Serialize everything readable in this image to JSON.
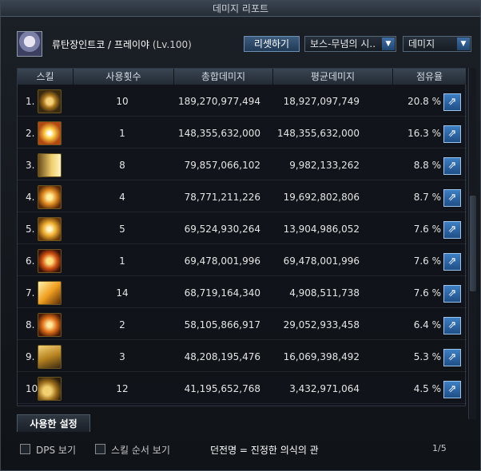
{
  "window": {
    "title": "데미지 리포트"
  },
  "header": {
    "char_name": "류탄장인트코 / 프레이야",
    "level": "(Lv.100)",
    "reset_label": "리셋하기",
    "dungeon_select": "보스-무념의 시..",
    "metric_select": "데미지"
  },
  "table": {
    "columns": [
      "스킬",
      "사용횟수",
      "총합데미지",
      "평균데미지",
      "점유율"
    ],
    "rows": [
      {
        "index": "1.",
        "icon": "golden-ring-icon",
        "count": "10",
        "total": "189,270,977,494",
        "avg": "18,927,097,749",
        "share": "20.8 %"
      },
      {
        "index": "2.",
        "icon": "sunburst-icon",
        "count": "1",
        "total": "148,355,632,000",
        "avg": "148,355,632,000",
        "share": "16.3 %"
      },
      {
        "index": "3.",
        "icon": "cannon-shot-icon",
        "count": "8",
        "total": "79,857,066,102",
        "avg": "9,982,133,262",
        "share": "8.8 %"
      },
      {
        "index": "4.",
        "icon": "explosion-icon",
        "count": "4",
        "total": "78,771,211,226",
        "avg": "19,692,802,806",
        "share": "8.7 %"
      },
      {
        "index": "5.",
        "icon": "scatter-blast-icon",
        "count": "5",
        "total": "69,524,930,264",
        "avg": "13,904,986,052",
        "share": "7.6 %"
      },
      {
        "index": "6.",
        "icon": "orange-sphere-icon",
        "count": "1",
        "total": "69,478,001,996",
        "avg": "69,478,001,996",
        "share": "7.6 %"
      },
      {
        "index": "7.",
        "icon": "beam-burst-icon",
        "count": "14",
        "total": "68,719,164,340",
        "avg": "4,908,511,738",
        "share": "7.6 %"
      },
      {
        "index": "8.",
        "icon": "fire-blast-icon",
        "count": "2",
        "total": "58,105,866,917",
        "avg": "29,052,933,458",
        "share": "6.4 %"
      },
      {
        "index": "9.",
        "icon": "missile-launcher-icon",
        "count": "3",
        "total": "48,208,195,476",
        "avg": "16,069,398,492",
        "share": "5.3 %"
      },
      {
        "index": "10.",
        "icon": "cannon-icon",
        "count": "12",
        "total": "41,195,652,768",
        "avg": "3,432,971,064",
        "share": "4.5 %"
      }
    ]
  },
  "tabs": {
    "used_settings": "사용한 설정"
  },
  "footer": {
    "dps_label": "DPS 보기",
    "skill_order_label": "스킬 순서 보기",
    "title_text": "던전명 = 진정한 의식의 관",
    "page": "1/5"
  },
  "colors": {
    "accent": "#3e7fc2",
    "header_bg": "#3a4654",
    "gold": "#c89a2a"
  }
}
